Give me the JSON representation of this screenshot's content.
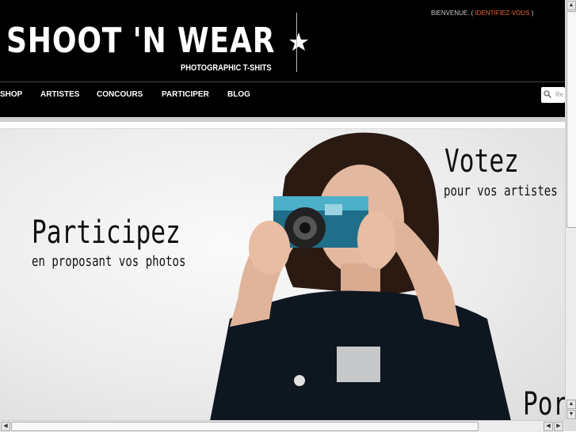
{
  "header": {
    "logo_text": "SHOOT 'N WEAR",
    "tagline": "PHOTOGRAPHIC T-SHITS",
    "welcome_prefix": "BIENVENUE. (",
    "login_link": "IDENTIFIEZ-VOUS",
    "welcome_suffix": ")"
  },
  "nav": {
    "items": [
      {
        "label": "SHOP"
      },
      {
        "label": "ARTISTES"
      },
      {
        "label": "CONCOURS"
      },
      {
        "label": "PARTICIPER"
      },
      {
        "label": "BLOG"
      }
    ],
    "search_placeholder": "Re"
  },
  "banner": {
    "left_title": "Participez",
    "left_subtitle": "en proposant vos photos",
    "right_title": "Votez",
    "right_subtitle": "pour vos artistes",
    "bottom_title": "Por"
  },
  "colors": {
    "header_bg": "#000000",
    "login_link": "#e8632a"
  }
}
